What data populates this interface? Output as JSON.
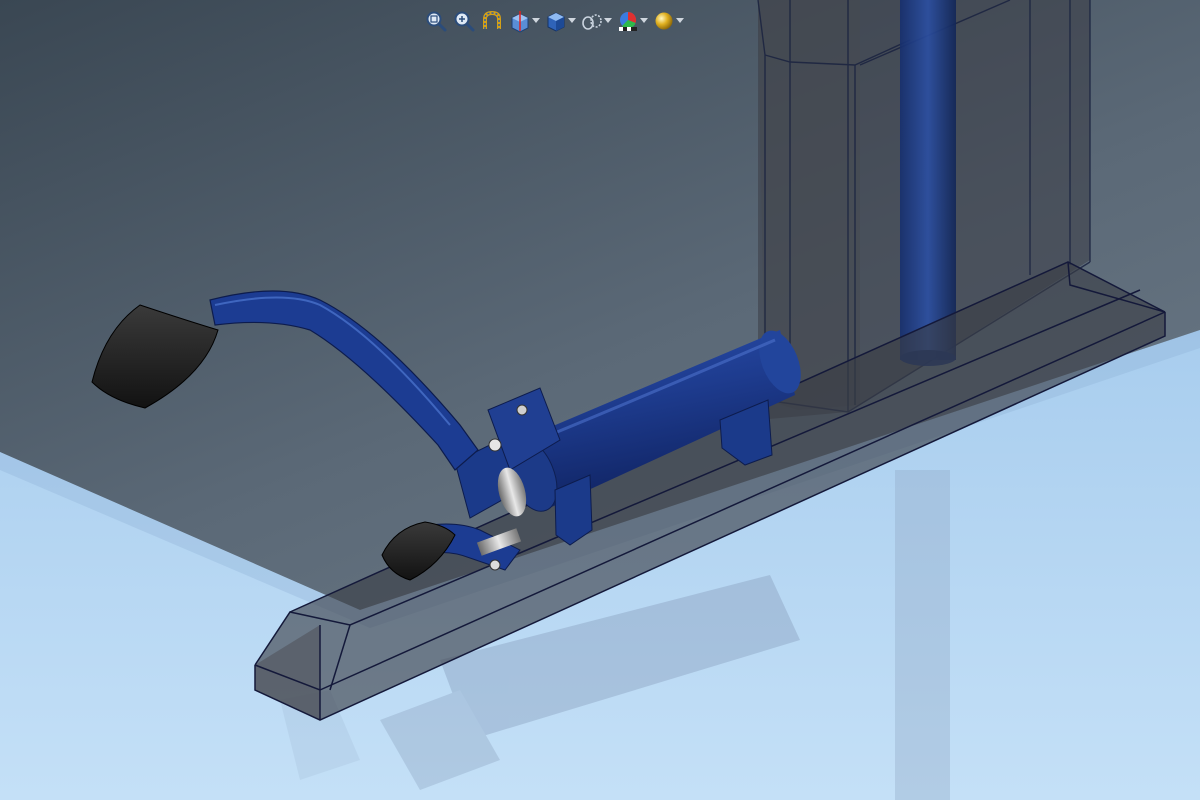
{
  "app": {
    "view_type": "3d-cad-viewport"
  },
  "heads_up_toolbar": {
    "tools": [
      {
        "id": "zoom-to-fit",
        "icon": "zoom-to-fit-icon",
        "has_dropdown": false
      },
      {
        "id": "zoom-to-area",
        "icon": "zoom-to-area-icon",
        "has_dropdown": false
      },
      {
        "id": "previous-view",
        "icon": "previous-view-icon",
        "has_dropdown": false
      },
      {
        "id": "section-view",
        "icon": "section-view-icon",
        "has_dropdown": true
      },
      {
        "id": "view-orientation",
        "icon": "view-orientation-icon",
        "has_dropdown": true
      },
      {
        "id": "display-style",
        "icon": "display-style-icon",
        "has_dropdown": true
      },
      {
        "id": "hide-show-items",
        "icon": "hide-show-items-icon",
        "has_dropdown": true
      },
      {
        "id": "edit-appearance",
        "icon": "edit-appearance-icon",
        "has_dropdown": true
      },
      {
        "id": "apply-scene",
        "icon": "apply-scene-icon",
        "has_dropdown": true
      }
    ]
  },
  "colors": {
    "background_top": "#3c4a57",
    "background_mid": "#5d6b79",
    "floor": "#b5d6f1",
    "part_blue": "#1b3a8a",
    "part_blue_light": "#3b63c0",
    "pedal_pad": "#1e1e1e",
    "transparent_edge": "#1a2340"
  }
}
